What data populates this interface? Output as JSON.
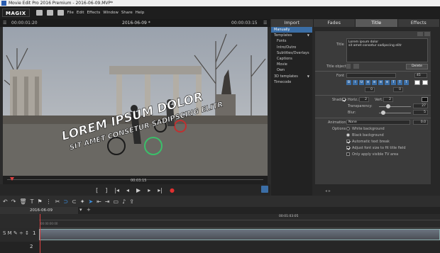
{
  "window": {
    "title": "Movie Edit Pro 2016 Premium - 2016-06-09.MVP*"
  },
  "menu": {
    "logo": "MAGIX",
    "items": [
      "File",
      "Edit",
      "Effects",
      "Window",
      "Share",
      "Help"
    ]
  },
  "tabs": [
    {
      "label": "Import",
      "active": false
    },
    {
      "label": "Fades",
      "active": false
    },
    {
      "label": "Title",
      "active": true
    },
    {
      "label": "Effects",
      "active": false
    }
  ],
  "preview": {
    "left_time": "00:00:01:20",
    "project": "2016-06-09 *",
    "right_time": "00:00:03:15",
    "title_line1": "LOREM IPSUM DOLOR",
    "title_line2": "SIT AMET CONSETUR SADIPSCING ELITR",
    "scrub_time": "00:03:15"
  },
  "title_list": [
    {
      "label": "Manually",
      "selected": true,
      "indent": false
    },
    {
      "label": "Templates",
      "selected": false,
      "indent": false,
      "arrow": true
    },
    {
      "label": "Fonts",
      "selected": false,
      "indent": true
    },
    {
      "label": "Intro/Outro",
      "selected": false,
      "indent": true
    },
    {
      "label": "Subtitles/Overlays",
      "selected": false,
      "indent": true
    },
    {
      "label": "Captions",
      "selected": false,
      "indent": true
    },
    {
      "label": "Movie",
      "selected": false,
      "indent": true
    },
    {
      "label": "Own",
      "selected": false,
      "indent": true
    },
    {
      "label": "3D templates",
      "selected": false,
      "indent": false,
      "arrow": true
    },
    {
      "label": "Timecode",
      "selected": false,
      "indent": false
    }
  ],
  "settings": {
    "title_label": "Title",
    "title_text1": "Lorem ipsum dolor",
    "title_text2": "sit amet consetur sadipscing elitr",
    "title_object_label": "Title object",
    "delete_label": "Delete",
    "font_label": "Font",
    "font_size": "45",
    "shadow_label": "Shadow",
    "horiz_label": "Horiz.:",
    "horiz_value": "2",
    "vert_label": "Vert.:",
    "vert_value": "2",
    "transparency_label": "Transparency:",
    "transparency_value": "27",
    "blur_label": "Blur:",
    "blur_value": "5",
    "animation_label": "Animation",
    "animation_value": "None",
    "animation_num": "0.0",
    "options_label": "Options",
    "opt_white": "White background",
    "opt_black": "Black background",
    "opt_autobreak": "Automatic text break",
    "opt_adjust": "Adjust font size to fit title field",
    "opt_tvarea": "Only apply visible TV area",
    "field_zero": "0",
    "field_zero2": "0"
  },
  "timeline": {
    "project_tab": "2016-06-09",
    "center_time": "00:01:03:05",
    "track1": "1",
    "track2": "2",
    "tick_label": "00:00:00:00"
  }
}
